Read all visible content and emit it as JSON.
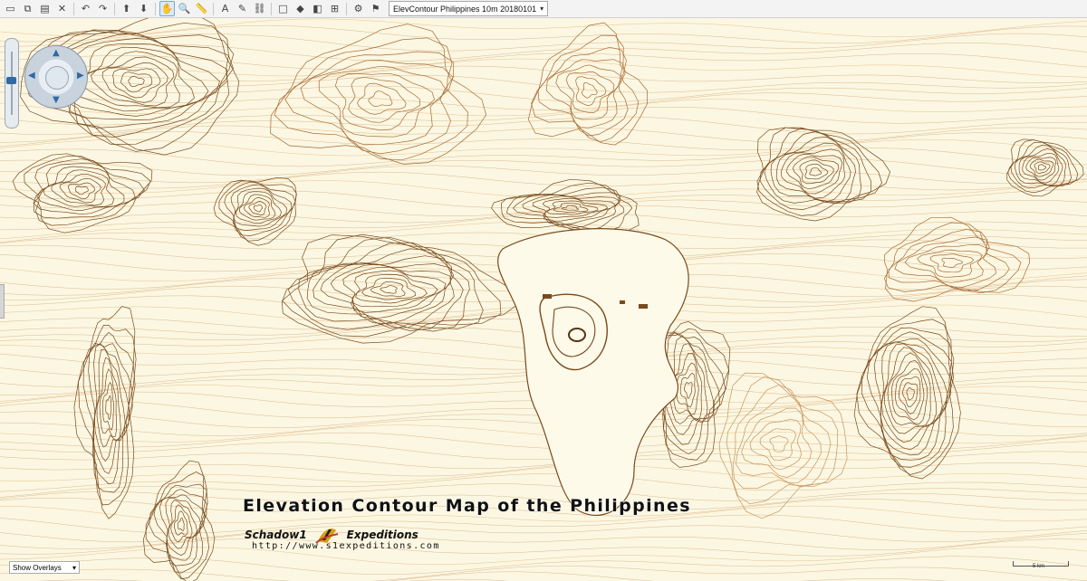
{
  "toolbar": {
    "buttons": [
      {
        "name": "open-icon",
        "glyph": "▭"
      },
      {
        "name": "copy-icon",
        "glyph": "⧉"
      },
      {
        "name": "paste-icon",
        "glyph": "▤"
      },
      {
        "name": "delete-icon",
        "glyph": "✕"
      },
      {
        "name": "undo-icon",
        "glyph": "↶"
      },
      {
        "name": "redo-icon",
        "glyph": "↷"
      },
      {
        "name": "import-icon",
        "glyph": "⬆"
      },
      {
        "name": "export-icon",
        "glyph": "⬇"
      },
      {
        "name": "pan-hand-icon",
        "glyph": "✋"
      },
      {
        "name": "zoom-icon",
        "glyph": "🔍"
      },
      {
        "name": "measure-icon",
        "glyph": "📏"
      },
      {
        "name": "text-label-icon",
        "glyph": "A"
      },
      {
        "name": "edit-pencil-icon",
        "glyph": "✎"
      },
      {
        "name": "link-icon",
        "glyph": "⛓"
      },
      {
        "name": "select-rect-icon",
        "glyph": "□"
      },
      {
        "name": "cube-3d-icon",
        "glyph": "◆"
      },
      {
        "name": "layers-icon",
        "glyph": "◧"
      },
      {
        "name": "grid-icon",
        "glyph": "⊞"
      },
      {
        "name": "settings-icon",
        "glyph": "⚙"
      },
      {
        "name": "gps-icon",
        "glyph": "⚑"
      }
    ],
    "map_select": "ElevContour Philippines 10m 20180101"
  },
  "map": {
    "title": "Elevation Contour Map of the Philippines",
    "brand_left": "Schadow1",
    "brand_right": "Expeditions",
    "url": "http://www.s1expeditions.com",
    "overlay_select": "Show Overlays",
    "scale_label": "5 km"
  },
  "colors": {
    "background": "#fbf7e2",
    "contour_dark": "#7a4a1c",
    "contour_mid": "#a86a32",
    "contour_light": "#c9955c",
    "contour_orange": "#e0a25a",
    "lake": "#fdfaea"
  }
}
